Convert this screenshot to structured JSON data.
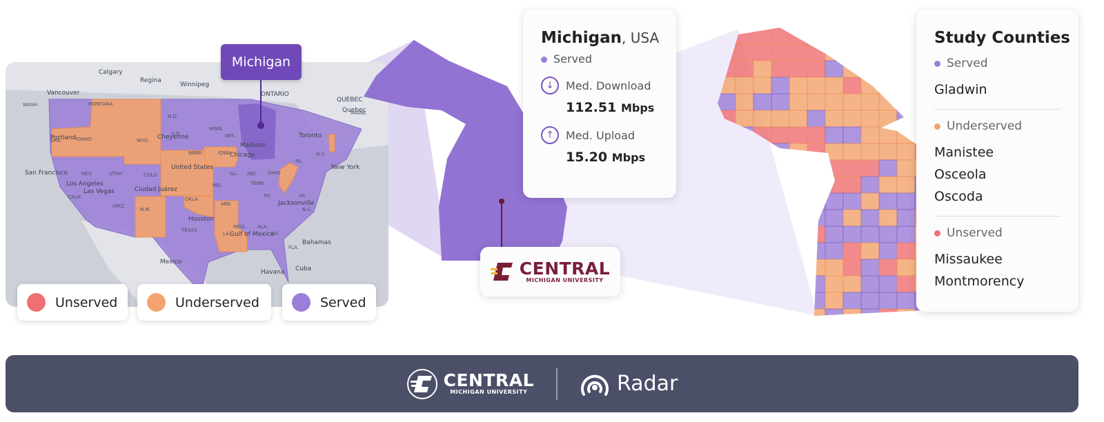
{
  "colors": {
    "unserved": "#ef6f73",
    "underserved": "#f3a46e",
    "served": "#9b7ed8",
    "accent": "#6f49b8",
    "brand": "#7a1f3a",
    "footer": "#4b5068"
  },
  "us_map": {
    "labels": [
      "Calgary",
      "Regina",
      "Winnipeg",
      "Vancouver",
      "Portland",
      "San Francisco",
      "Los Angeles",
      "Las Vegas",
      "Chicago",
      "Toronto",
      "New York",
      "Quebec",
      "Houston",
      "Mexico",
      "Cuba",
      "Gulf of Mexico",
      "United States",
      "Jacksonville",
      "Havana",
      "Ciudad Juárez",
      "Cheyenne",
      "Madison",
      "ONTARIO",
      "QUEBEC",
      "Bahamas",
      "WASH.",
      "MONTANA",
      "ORE.",
      "IDAHO",
      "WYO.",
      "N.D.",
      "S.D.",
      "MINN.",
      "WIS.",
      "NEBR.",
      "IOWA",
      "NEV.",
      "UTAH",
      "COLO.",
      "CALIF.",
      "ARIZ.",
      "N.M.",
      "TEXAS",
      "OKLA.",
      "ARK.",
      "MO.",
      "ILL.",
      "IND.",
      "OHIO",
      "PA.",
      "N.Y.",
      "KY.",
      "VA.",
      "TENN.",
      "N.C.",
      "MISS.",
      "ALA.",
      "GA.",
      "LA.",
      "FLA.",
      "MAINE"
    ],
    "highlight_label": "Michigan"
  },
  "legend": [
    {
      "label": "Unserved",
      "status": "unserved"
    },
    {
      "label": "Underserved",
      "status": "underserved"
    },
    {
      "label": "Served",
      "status": "served"
    }
  ],
  "info": {
    "state": "Michigan",
    "country": ", USA",
    "status": "Served",
    "download_label": "Med. Download",
    "download_value": "112.51",
    "download_unit": "Mbps",
    "upload_label": "Med. Upload",
    "upload_value": "15.20",
    "upload_unit": "Mbps",
    "download_icon": "arrow-down-circle-icon",
    "upload_icon": "arrow-up-circle-icon"
  },
  "logo": {
    "word": "CENTRAL",
    "sub": "MICHIGAN UNIVERSITY"
  },
  "study": {
    "title": "Study Counties",
    "groups": [
      {
        "status": "served",
        "label": "Served",
        "counties": [
          "Gladwin"
        ]
      },
      {
        "status": "underserved",
        "label": "Underserved",
        "counties": [
          "Manistee",
          "Osceola",
          "Oscoda"
        ]
      },
      {
        "status": "unserved",
        "label": "Unserved",
        "counties": [
          "Missaukee",
          "Montmorency"
        ]
      }
    ]
  },
  "footer": {
    "cmu_word": "CENTRAL",
    "cmu_sub": "MICHIGAN UNIVERSITY",
    "radar_label": "Radar",
    "radar_icon": "radar-signal-icon"
  }
}
